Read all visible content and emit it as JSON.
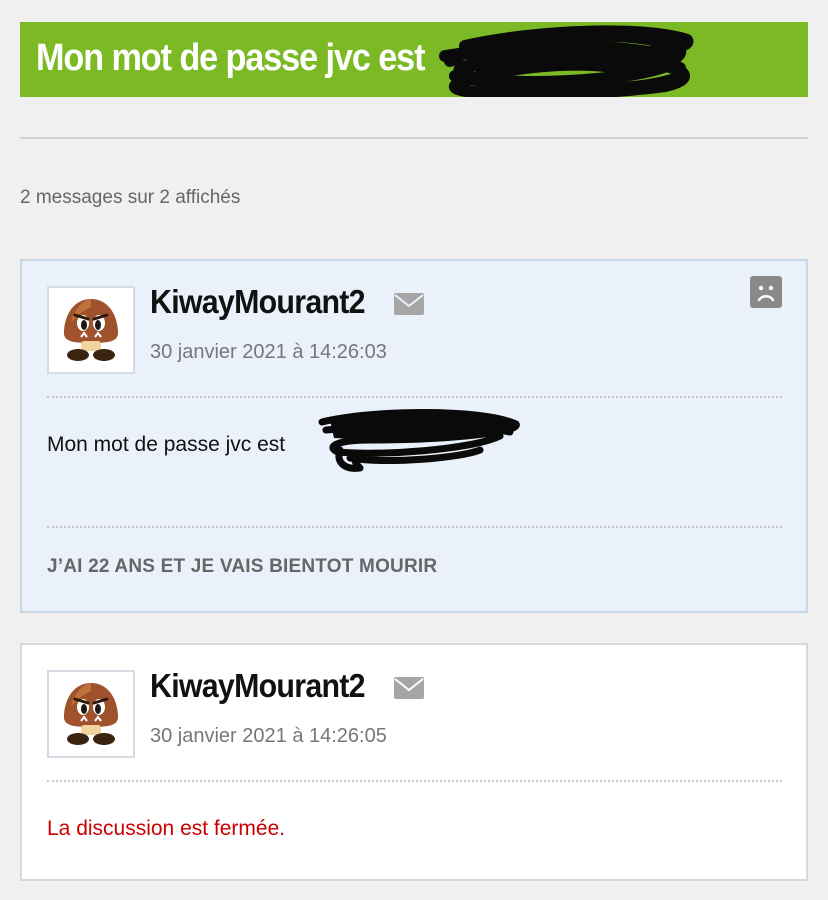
{
  "topic": {
    "title": "Mon mot de passe jvc est",
    "title_bar_color": "#7bba25"
  },
  "pagination": {
    "count_text": "2 messages sur 2 affichés"
  },
  "messages": [
    {
      "author": "KiwayMourant2",
      "date": "30 janvier 2021 à 14:26:03",
      "body": "Mon mot de passe jvc est",
      "signature": "J’AI 22 ANS ET JE VAIS BIENTOT MOURIR",
      "avatar": "goomba-avatar",
      "icons": [
        "mail-icon",
        "report-icon"
      ]
    },
    {
      "author": "KiwayMourant2",
      "date": "30 janvier 2021 à 14:26:05",
      "closed_notice": "La discussion est fermée.",
      "avatar": "goomba-avatar",
      "icons": [
        "mail-icon"
      ]
    }
  ]
}
